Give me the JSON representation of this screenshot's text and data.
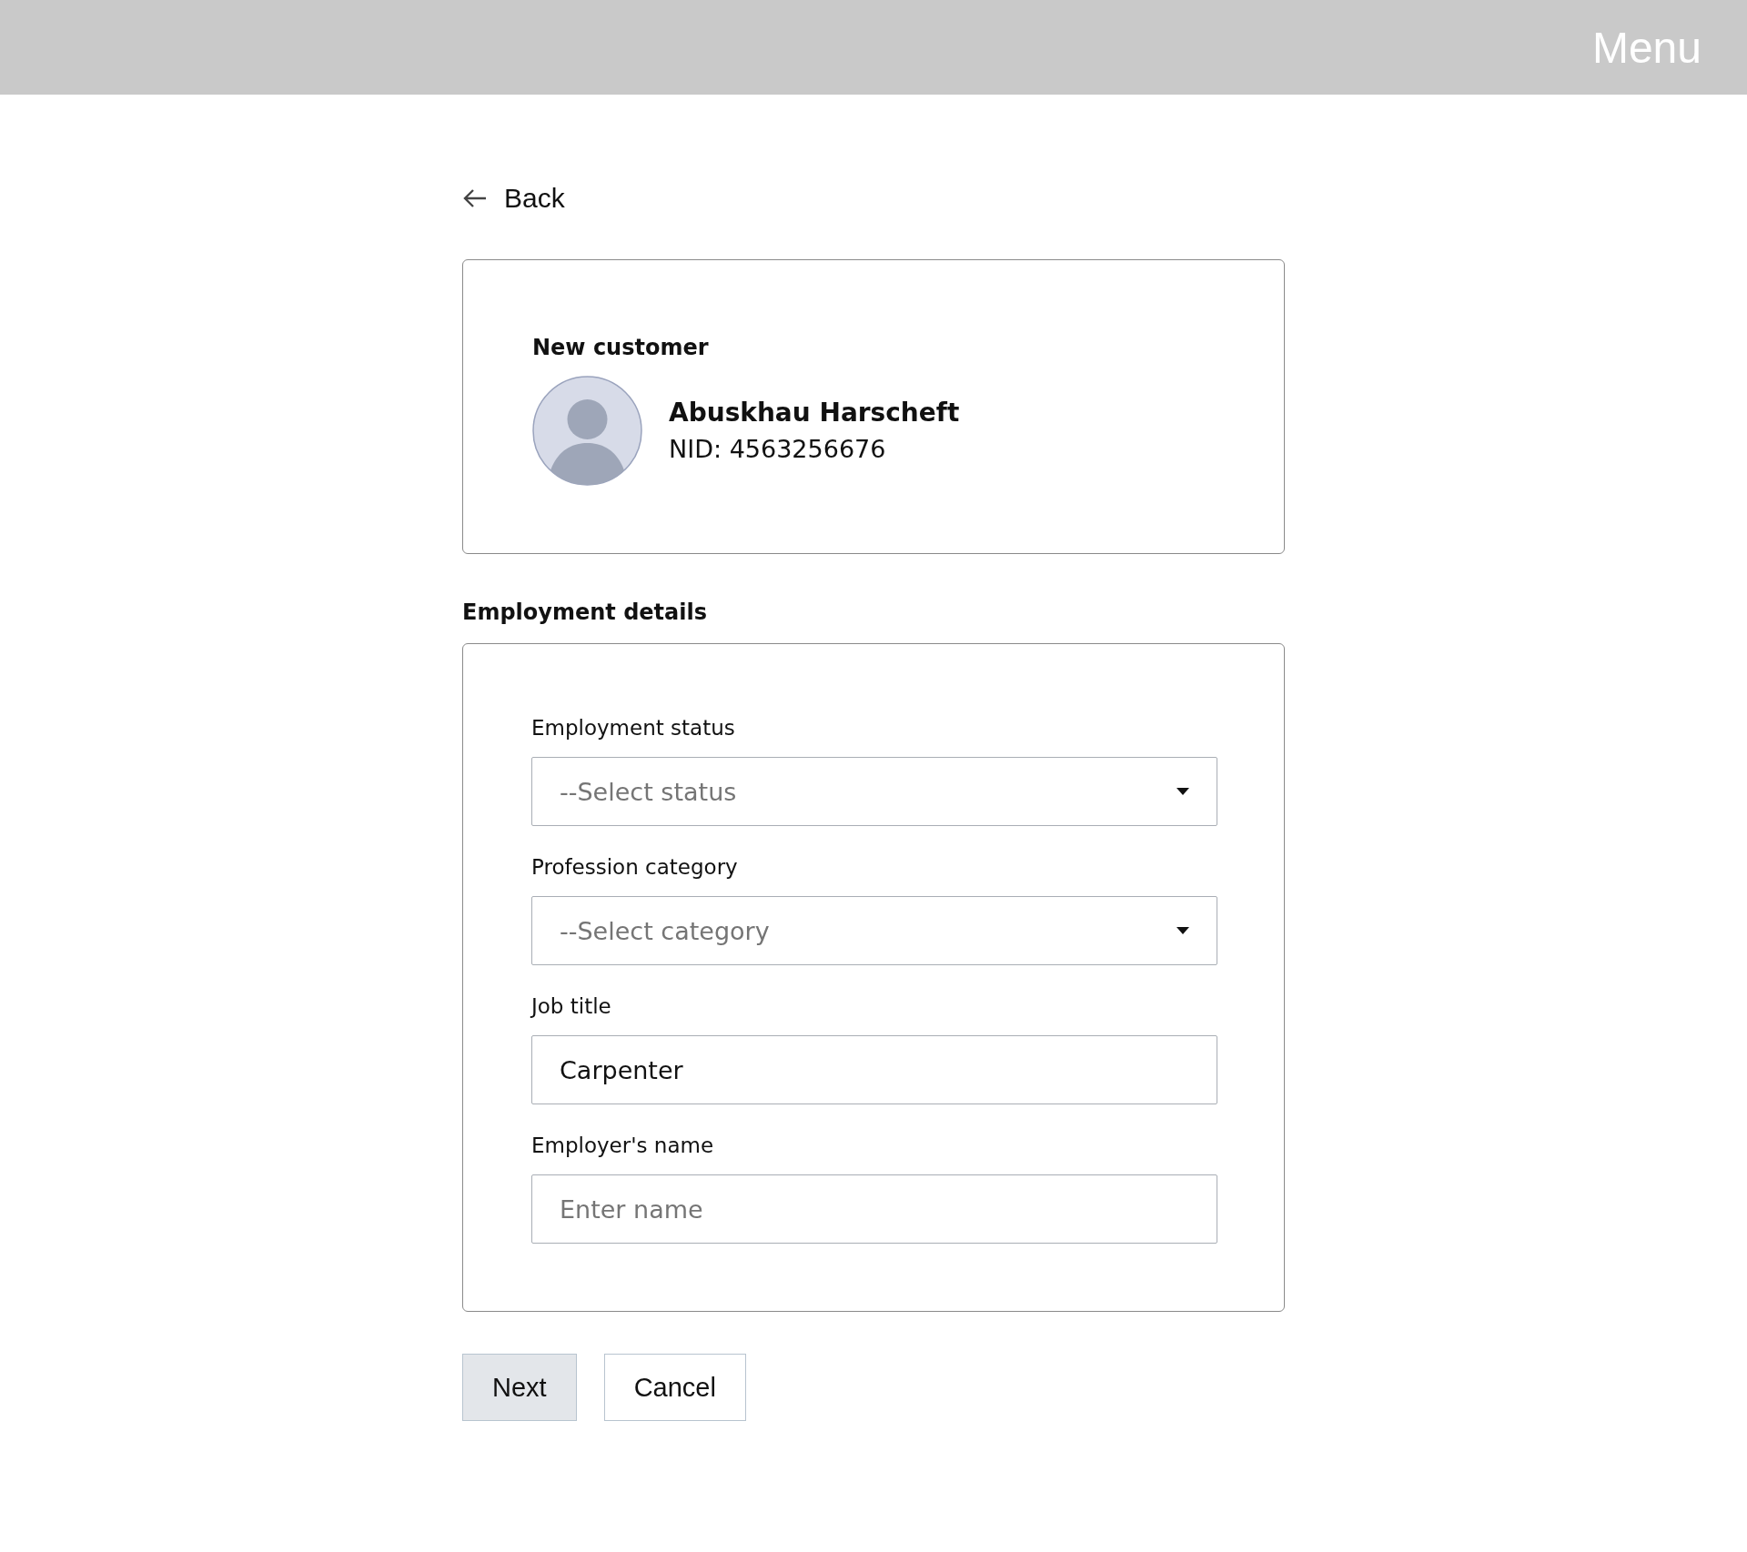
{
  "header": {
    "menu": "Menu"
  },
  "back": {
    "label": "Back"
  },
  "customer_card": {
    "heading": "New customer",
    "name": "Abuskhau Harscheft",
    "nid": "NID: 4563256676"
  },
  "employment": {
    "heading": "Employment details",
    "fields": [
      {
        "kind": "select",
        "label": "Employment status",
        "placeholder": "--Select status"
      },
      {
        "kind": "select",
        "label": "Profession category",
        "placeholder": "--Select category"
      },
      {
        "kind": "text",
        "label": "Job title",
        "value": "Carpenter"
      },
      {
        "kind": "text",
        "label": "Employer's name",
        "placeholder": "Enter name"
      }
    ]
  },
  "buttons": [
    {
      "label": "Next",
      "primary": true
    },
    {
      "label": "Cancel",
      "primary": false
    }
  ]
}
